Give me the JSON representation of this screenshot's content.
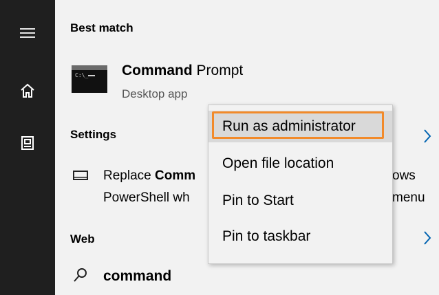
{
  "rail": {
    "icons": [
      "hamburger-icon",
      "home-icon",
      "notebook-icon"
    ]
  },
  "best_match": {
    "section_label": "Best match",
    "app": {
      "name_bold": "Command",
      "name_rest": " Prompt",
      "type": "Desktop app",
      "icon": "cmd-icon"
    }
  },
  "settings": {
    "section_label": "Settings",
    "item": {
      "line1_pre": "Replace ",
      "line1_bold": "Comm",
      "line1_right": "ows",
      "line2_left": "PowerShell wh",
      "line2_right": "menu",
      "icon": "monitor-icon"
    }
  },
  "web": {
    "section_label": "Web",
    "query": "command",
    "icon": "search-icon"
  },
  "context_menu": {
    "items": [
      "Run as administrator",
      "Open file location",
      "Pin to Start",
      "Pin to taskbar"
    ],
    "highlighted_index": 0,
    "highlight_color": "#f28a2a"
  },
  "colors": {
    "rail_bg": "#1f1f1f",
    "panel_bg": "#f2f2f2",
    "accent_chevron": "#0063b1"
  }
}
